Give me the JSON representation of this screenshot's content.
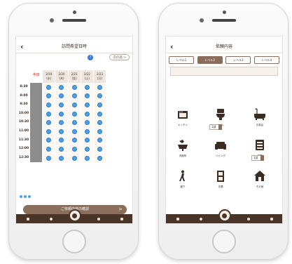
{
  "theme": {
    "accent": "#8a6d5b",
    "dark": "#4a3427",
    "available_slot": "#4aa1e6",
    "alert": "#e1544f"
  },
  "left": {
    "title": "訪問希望日時",
    "back_icon": "chevron-left-icon",
    "help_icon": "?",
    "next_week_label": "次の週 >",
    "today_label": "今日",
    "days": [
      {
        "date": "2/19",
        "dow": "(水)"
      },
      {
        "date": "2/20",
        "dow": "(木)"
      },
      {
        "date": "2/21",
        "dow": "(金)"
      },
      {
        "date": "2/22",
        "dow": "(土)"
      },
      {
        "date": "2/23",
        "dow": "(日)"
      }
    ],
    "times": [
      "8:30",
      "9:00",
      "9:30",
      "10:00",
      "10:30",
      "11:00",
      "11:30",
      "12:00",
      "12:30"
    ],
    "cta_label": "ご依頼内容の確認",
    "cta_arrow": ">"
  },
  "right": {
    "title": "依頼内容",
    "back_icon": "chevron-left-icon",
    "levels": [
      "レベル1",
      "レベル2",
      "レベル3",
      "レベル4"
    ],
    "active_level_index": 1,
    "places": [
      {
        "name": "キッチン",
        "icon": "kitchen-icon",
        "count": ""
      },
      {
        "name": "トイレ",
        "icon": "toilet-icon",
        "count": "1部"
      },
      {
        "name": "お風呂",
        "icon": "bathtub-icon",
        "count": ""
      },
      {
        "name": "洗面所",
        "icon": "washbasin-icon",
        "count": ""
      },
      {
        "name": "リビング",
        "icon": "sofa-icon",
        "count": ""
      },
      {
        "name": "部屋",
        "icon": "dresser-icon",
        "count": "1部"
      },
      {
        "name": "廊下",
        "icon": "walking-person-icon",
        "count": ""
      },
      {
        "name": "玄関",
        "icon": "door-icon",
        "count": ""
      },
      {
        "name": "その他",
        "icon": "house-icon",
        "count": ""
      }
    ]
  }
}
